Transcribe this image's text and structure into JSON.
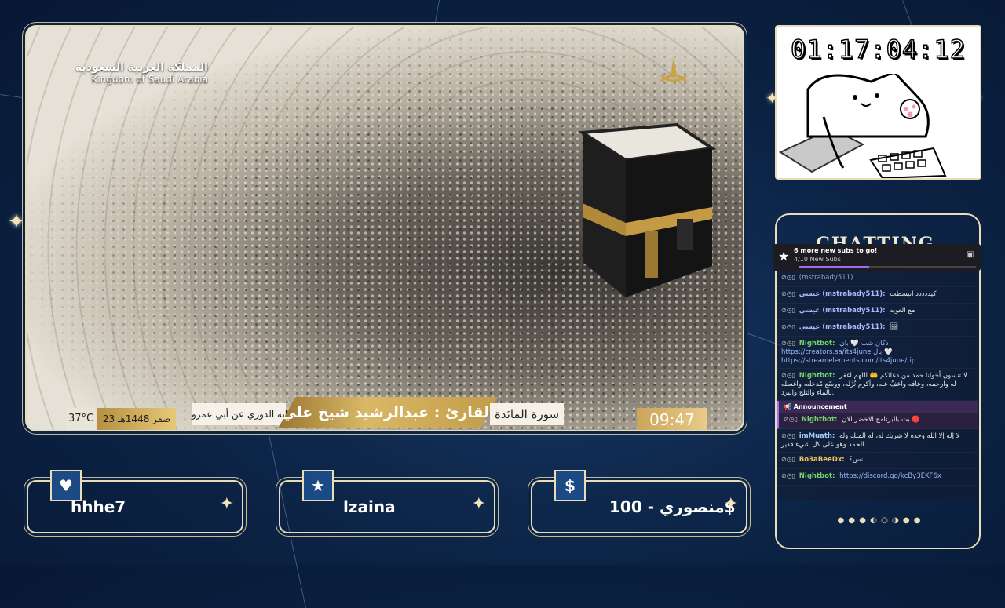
{
  "video": {
    "channel_name_ar": "المملكة العربية السعودية",
    "channel_name_en": "Kingdom of Saudi Arabia",
    "temperature": "37°C",
    "hijri_date": "23 صفر 1448هـ",
    "riwaya": "رواية الدوري عن أبي عمرو",
    "reciter": "القارئ : عبدالرشيد شيخ علي",
    "surah": "سورة المائدة",
    "clock": "09:47"
  },
  "timer": {
    "value": "01:17:04:12"
  },
  "chat": {
    "title": "CHATTING",
    "goal": {
      "title": "6 more new subs to go!",
      "progress_text": "4/10 New Subs",
      "progress": 0.4
    },
    "messages": [
      {
        "nick": "",
        "text": "(mstrabady511)",
        "kind": "muted"
      },
      {
        "nick": "عيشي (mstrabady511):",
        "text": "اكيددددد انبسطت",
        "kind": "user"
      },
      {
        "nick": "عيشي (mstrabady511):",
        "text": "مع العويه",
        "kind": "user"
      },
      {
        "nick": "عيشي (mstrabady511):",
        "text": "🖼",
        "kind": "user"
      },
      {
        "nick": "Nightbot:",
        "text": "دكان شب 🤍 باي https://creators.sa/its4june بال 🤍 https://streamelements.com/its4june/tip",
        "kind": "bot"
      },
      {
        "nick": "Nightbot:",
        "text": "لا تنسون أخوانا حمد من دعائكم 🤲 اللهم اغفر له وارحمه، وعافه واعفُ عنه، وأكرم نُزُله، ووسّع مُدخله، واغسله بالماء والثلج والبرد.",
        "kind": "bot"
      },
      {
        "nick": "Nightbot:",
        "text": "بث بالبرنامج الاخضر الان 🔴",
        "kind": "bot",
        "announcement": true
      },
      {
        "nick": "imMuath:",
        "text": "لا إله إلا الله وحده لا شريك له، له الملك وله الحمد وهو على كل شيء قدير.",
        "kind": "sub"
      },
      {
        "nick": "Bo3aBeeDx:",
        "text": "نس؟",
        "kind": "beee"
      },
      {
        "nick": "Nightbot:",
        "text": "https://discord.gg/kcBy3EKF6x",
        "kind": "bot",
        "link": true
      }
    ],
    "announcement_label": "📢 Announcement"
  },
  "alerts": {
    "follower": {
      "name": "hhhe7",
      "icon": "heart-icon"
    },
    "subscriber": {
      "name": "lzaina",
      "icon": "star-icon"
    },
    "donation": {
      "name": "منصوري - 100$",
      "icon": "dollar-icon"
    }
  },
  "colors": {
    "frame": "#e9dcb8",
    "badge": "#1b4a85",
    "background": "#0c2447",
    "gold": "#d9b866"
  }
}
